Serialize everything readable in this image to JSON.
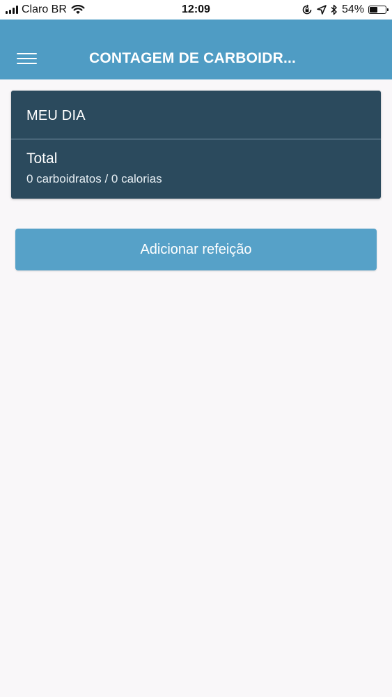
{
  "status_bar": {
    "carrier": "Claro BR",
    "time": "12:09",
    "battery_percent": "54%",
    "battery_level": 0.54,
    "icons": [
      "signal-icon",
      "wifi-icon",
      "orientation-lock-icon",
      "location-arrow-icon",
      "bluetooth-icon",
      "battery-icon"
    ]
  },
  "header": {
    "title": "CONTAGEM DE CARBOIDR...",
    "menu_icon": "hamburger-menu-icon",
    "background_color": "#4f9cc4"
  },
  "day_card": {
    "title": "MEU DIA",
    "total_label": "Total",
    "summary": "0 carboidratos / 0 calorias",
    "background_color": "#2b4a5d"
  },
  "actions": {
    "add_meal_label": "Adicionar refeição",
    "button_color": "#56a1c8"
  }
}
